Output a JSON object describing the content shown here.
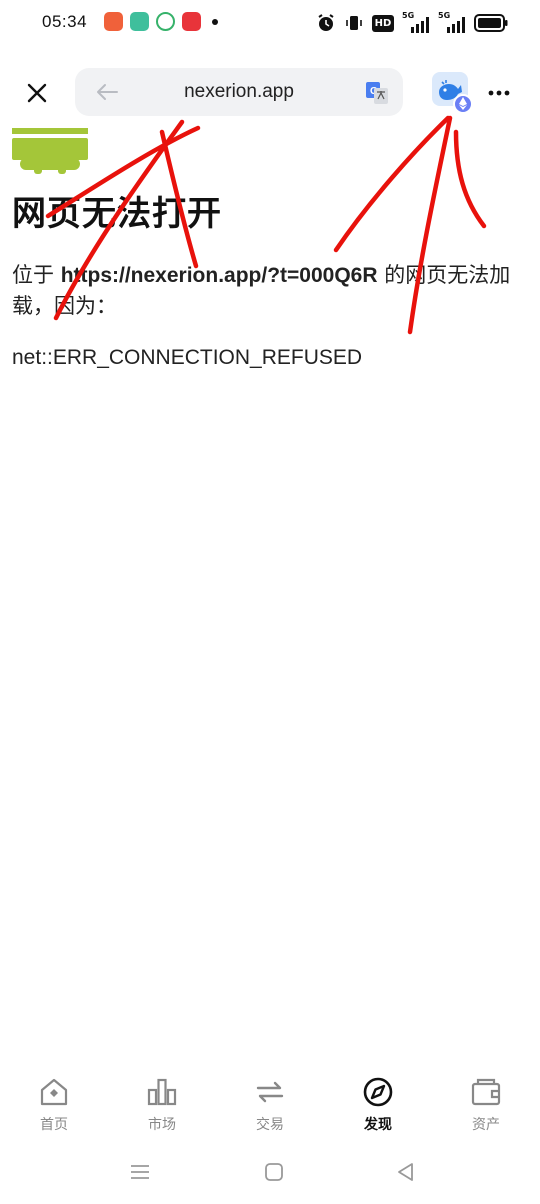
{
  "status_bar": {
    "time": "05:34",
    "hd_label": "HD",
    "net_label_1": "5G",
    "net_label_2": "5G"
  },
  "browser": {
    "url": "nexerion.app"
  },
  "error_page": {
    "title": "网页无法打开",
    "message_prefix": "位于 ",
    "url": "https://nexerion.app/?t=000Q6R",
    "message_suffix": " 的网页无法加载，因为：",
    "error_code": "net::ERR_CONNECTION_REFUSED"
  },
  "bottom_nav": [
    {
      "label": "首页",
      "icon": "home-icon"
    },
    {
      "label": "市场",
      "icon": "bar-chart-icon"
    },
    {
      "label": "交易",
      "icon": "swap-icon"
    },
    {
      "label": "发现",
      "icon": "compass-icon"
    },
    {
      "label": "资产",
      "icon": "wallet-icon"
    }
  ],
  "active_nav": "发现",
  "colors": {
    "accent": "#111111",
    "scribble": "#e8120c",
    "android_green": "#a4c639",
    "url_bg": "#f1f2f4",
    "inactive": "#888888"
  }
}
